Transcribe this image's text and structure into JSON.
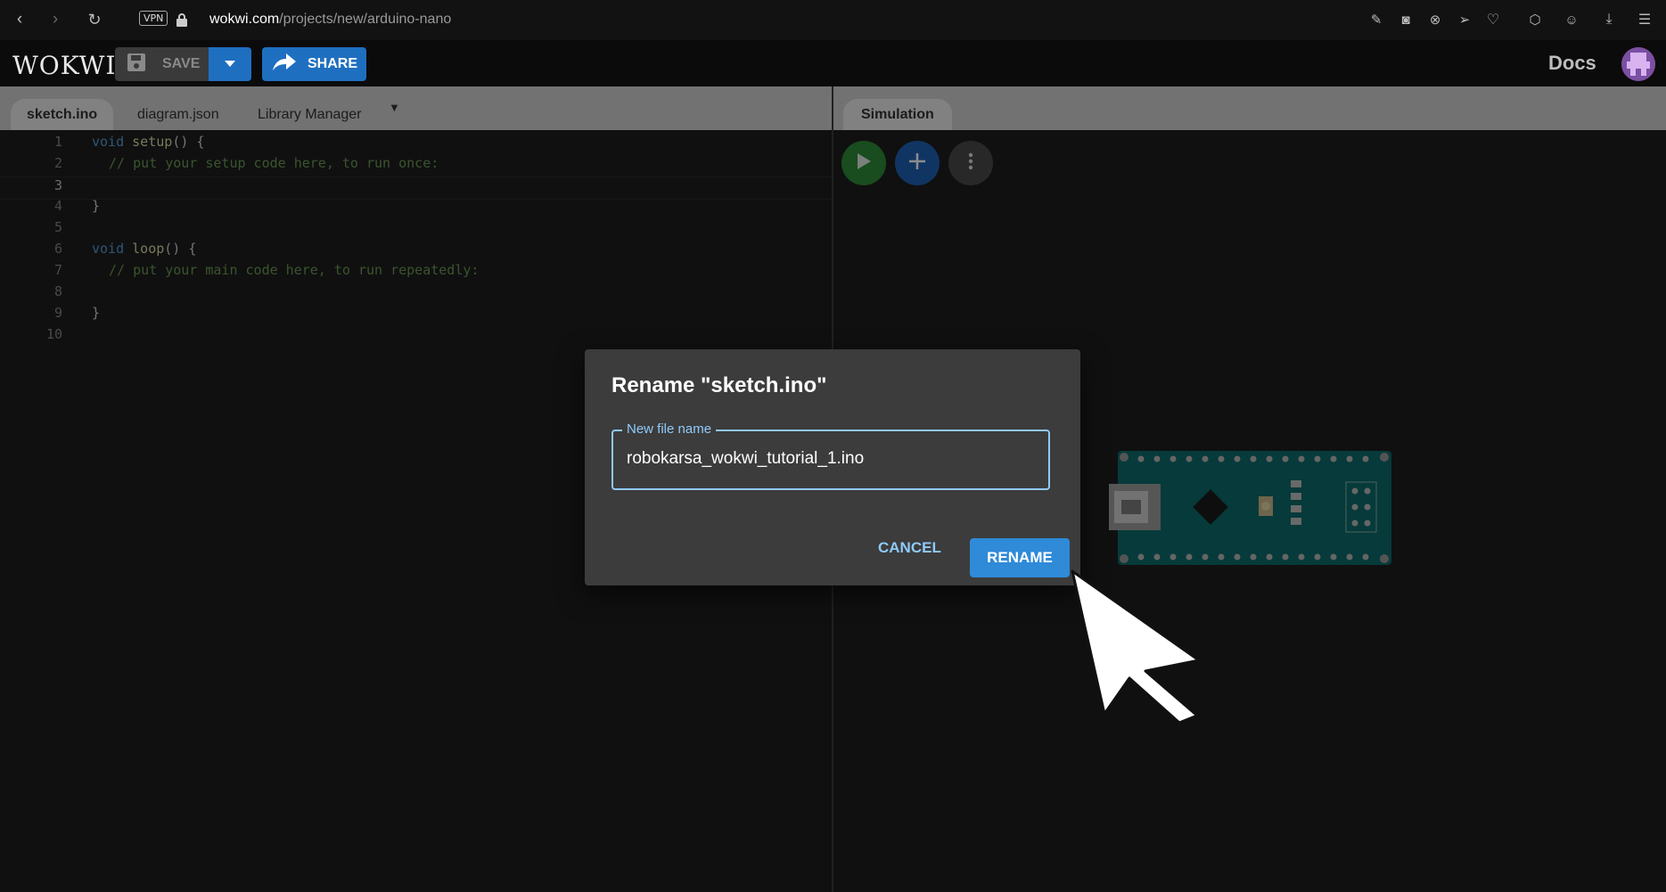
{
  "browser": {
    "vpn_label": "VPN",
    "url_host": "wokwi.com",
    "url_path": "/projects/new/arduino-nano"
  },
  "header": {
    "logo": "WOKWI",
    "save_label": "SAVE",
    "share_label": "SHARE",
    "docs_label": "Docs"
  },
  "editor": {
    "tabs": [
      {
        "label": "sketch.ino"
      },
      {
        "label": "diagram.json"
      },
      {
        "label": "Library Manager"
      }
    ],
    "lines": [
      {
        "n": "1"
      },
      {
        "n": "2",
        "comment": "// put your setup code here, to run once:"
      },
      {
        "n": "3"
      },
      {
        "n": "4",
        "text": "}"
      },
      {
        "n": "5"
      },
      {
        "n": "6"
      },
      {
        "n": "7",
        "comment": "// put your main code here, to run repeatedly:"
      },
      {
        "n": "8"
      },
      {
        "n": "9",
        "text": "}"
      },
      {
        "n": "10"
      }
    ],
    "line1": {
      "kw": "void",
      "fn": "setup",
      "rest": "() {"
    },
    "line6": {
      "kw": "void",
      "fn": "loop",
      "rest": "() {"
    }
  },
  "simulation": {
    "tab_label": "Simulation"
  },
  "dialog": {
    "title": "Rename \"sketch.ino\"",
    "field_label": "New file name",
    "field_value": "robokarsa_wokwi_tutorial_1.ino",
    "cancel_label": "CANCEL",
    "rename_label": "RENAME"
  },
  "colors": {
    "accent_blue": "#1f6fc0",
    "rename_blue": "#2f8ad8",
    "field_border": "#90caf9",
    "run_green": "#2e8b3a"
  }
}
